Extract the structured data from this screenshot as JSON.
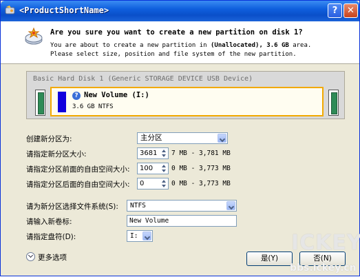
{
  "window": {
    "title": "<ProductShortName>",
    "help_glyph": "?",
    "close_glyph": "✕"
  },
  "header": {
    "question": "Are you sure you want to create a new partition on disk 1?",
    "desc_pre": "You are about to create a new partition in ",
    "desc_bold": "(Unallocated), 3.6 GB",
    "desc_post": " area.",
    "desc_line2": "Please select size, position and file system of the new partition."
  },
  "disk": {
    "title": "Basic Hard Disk 1 (Generic STORAGE DEVICE USB Device)",
    "partition_name": "New Volume (I:)",
    "partition_size": "3.6 GB NTFS",
    "partition_icon": "?"
  },
  "form": {
    "partition_type_label": "创建新分区为:",
    "partition_type_value": "主分区",
    "size_label": "请指定新分区大小:",
    "size_value": "3681",
    "size_range": "7 MB - 3,781 MB",
    "free_before_label": "请指定分区前面的自由空间大小:",
    "free_before_value": "100",
    "free_before_range": "0 MB - 3,773 MB",
    "free_after_label": "请指定分区后面的自由空间大小:",
    "free_after_value": "0",
    "free_after_range": "0 MB - 3,773 MB",
    "filesystem_label": "请为新分区选择文件系统(S):",
    "filesystem_value": "NTFS",
    "volume_label_label": "请输入新卷标:",
    "volume_label_value": "New Volume",
    "drive_letter_label": "请指定盘符(D):",
    "drive_letter_value": "I:"
  },
  "footer": {
    "more_options": "更多选项",
    "ok_label": "是(Y)",
    "cancel_label": "否(N)"
  },
  "watermark": {
    "logo_text": "ICKEY",
    "url": "bbs.ickey.cn"
  },
  "colors": {
    "titlebar": "#0a4fc9",
    "partition_border": "#f2a900",
    "partition_bar": "#1100dd",
    "side_block": "#2e8b57"
  },
  "icons": {
    "title": "app-disk-icon",
    "header": "new-partition-disk-icon",
    "help": "help-icon",
    "close": "close-icon",
    "more": "expand-chevron-icon"
  }
}
